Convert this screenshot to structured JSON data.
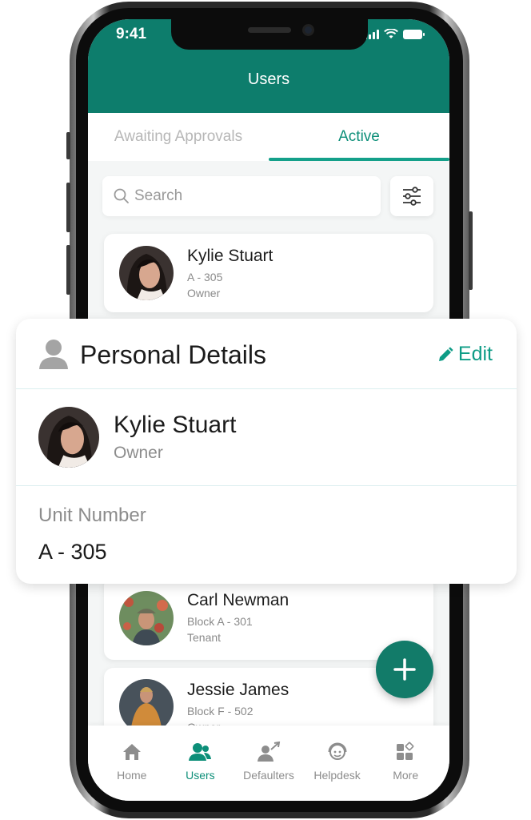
{
  "status_bar": {
    "time": "9:41"
  },
  "header": {
    "title": "Users"
  },
  "tabs": [
    {
      "label": "Awaiting Approvals",
      "active": false
    },
    {
      "label": "Active",
      "active": true
    }
  ],
  "search": {
    "placeholder": "Search"
  },
  "users": [
    {
      "name": "Kylie Stuart",
      "unit": "A - 305",
      "role": "Owner"
    },
    {
      "name": "Carl Newman",
      "unit": "Block A - 301",
      "role": "Tenant"
    },
    {
      "name": "Jessie James",
      "unit": "Block F - 502",
      "role": "Owner"
    }
  ],
  "detail": {
    "title": "Personal Details",
    "edit_label": "Edit",
    "name": "Kylie Stuart",
    "role": "Owner",
    "unit_label": "Unit Number",
    "unit_value": "A - 305"
  },
  "bottom_nav": [
    {
      "label": "Home",
      "icon": "home-icon",
      "active": false
    },
    {
      "label": "Users",
      "icon": "users-icon",
      "active": true
    },
    {
      "label": "Defaulters",
      "icon": "defaulters-icon",
      "active": false
    },
    {
      "label": "Helpdesk",
      "icon": "helpdesk-icon",
      "active": false
    },
    {
      "label": "More",
      "icon": "more-icon",
      "active": false
    }
  ],
  "colors": {
    "primary": "#0d7d6c",
    "accent": "#14a08a",
    "fab": "#127b69"
  }
}
